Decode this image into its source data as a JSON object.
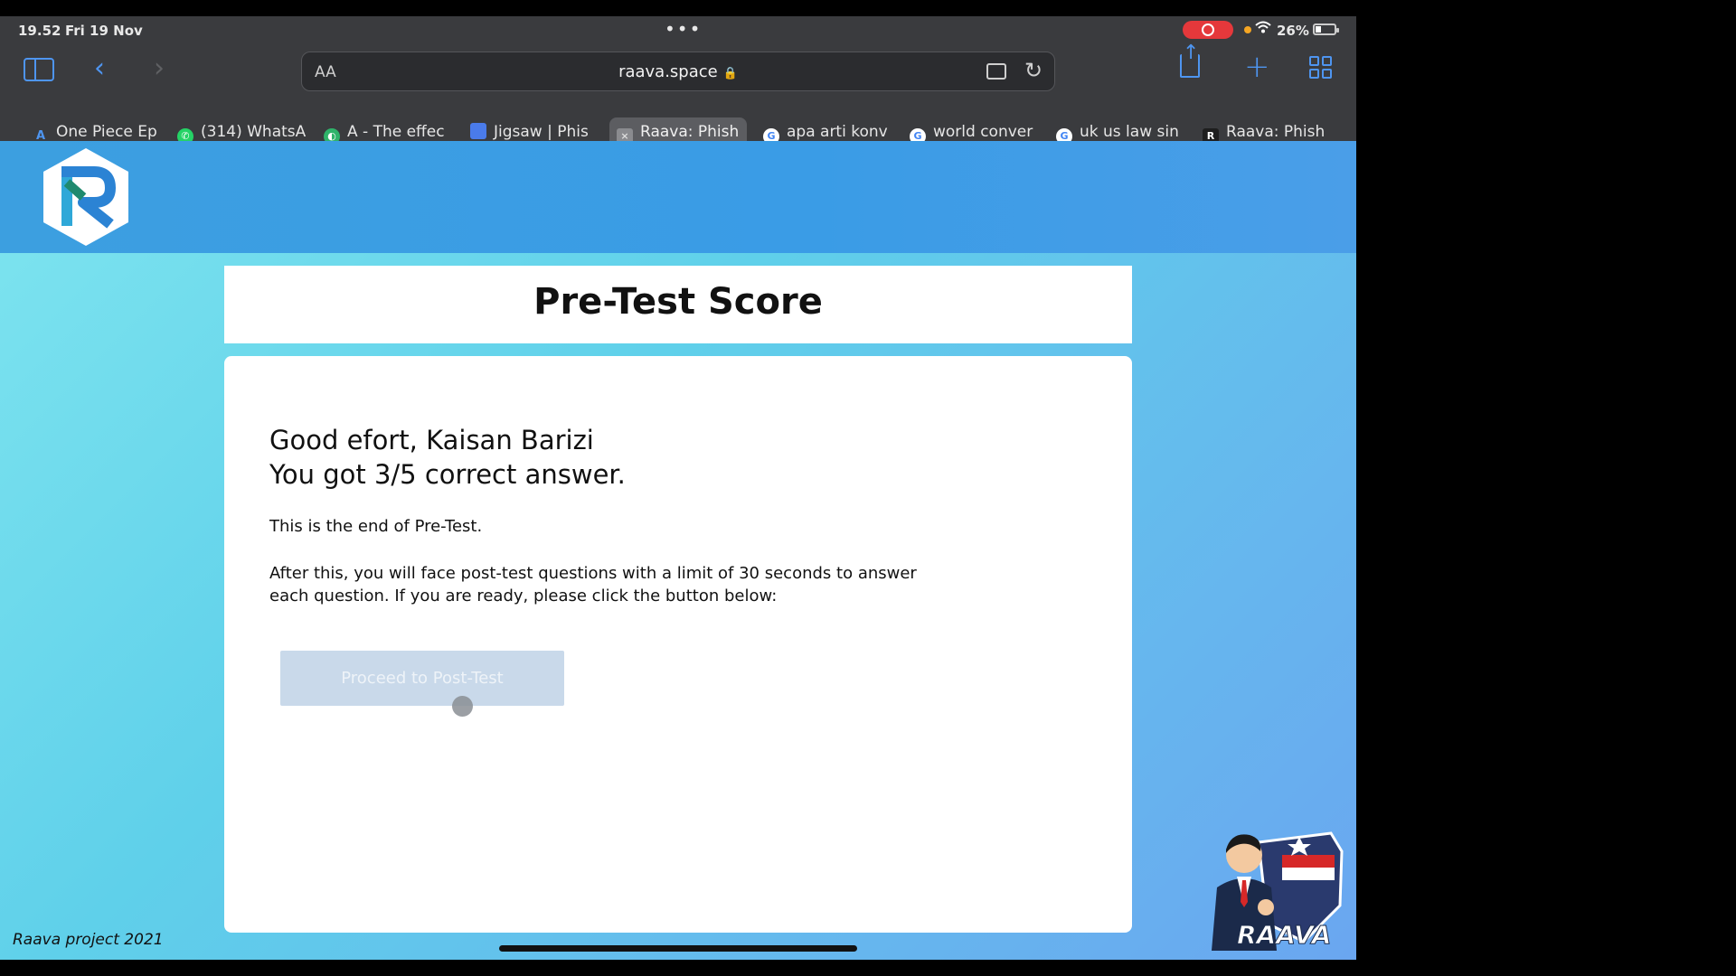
{
  "status_bar": {
    "time": "19.52",
    "date": "Fri 19 Nov",
    "battery": "26%"
  },
  "browser": {
    "text_size_button": "AA",
    "url": "raava.space",
    "tabs": [
      {
        "label": "One Piece Ep",
        "favicon": "a-icon",
        "active": false
      },
      {
        "label": "(314) WhatsA",
        "favicon": "whatsapp-icon",
        "active": false
      },
      {
        "label": "A - The effec",
        "favicon": "green-app-icon",
        "active": false
      },
      {
        "label": "Jigsaw | Phis",
        "favicon": "blue-square-icon",
        "active": false
      },
      {
        "label": "Raava: Phish",
        "favicon": "raava-icon",
        "active": true
      },
      {
        "label": "apa arti konv",
        "favicon": "google-icon",
        "active": false
      },
      {
        "label": "world conver",
        "favicon": "google-icon",
        "active": false
      },
      {
        "label": "uk us law sin",
        "favicon": "google-icon",
        "active": false
      },
      {
        "label": "Raava: Phish",
        "favicon": "r-icon",
        "active": false
      }
    ]
  },
  "page": {
    "title": "Pre-Test Score",
    "greeting_line1": "Good efort, Kaisan Barizi",
    "greeting_line2": "You got 3/5 correct answer.",
    "end_text": "This is the end of Pre-Test.",
    "info_text": "After this, you will face post-test questions with a limit of 30 seconds to answer each question. If you are ready, please click the button below:",
    "proceed_button": "Proceed to Post-Test",
    "footer": "Raava project 2021",
    "mascot_caption": "RAAVA"
  },
  "colors": {
    "header_blue": "#3c9fe0",
    "page_gradient_start": "#7fe5ef",
    "page_gradient_end": "#6aa6f0",
    "button_disabled": "#c9d9ea",
    "chrome_dark": "#3a3b3e",
    "accent_blue": "#4e95f0"
  }
}
